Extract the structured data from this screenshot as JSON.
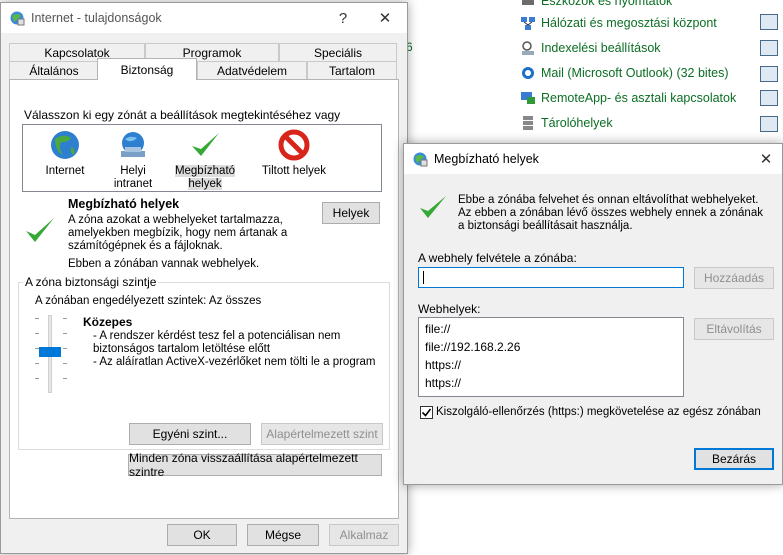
{
  "background": {
    "top_fragment": "",
    "items": [
      {
        "label": "Eszközök és nyomtatók",
        "icon": "printer-icon"
      },
      {
        "label": "Hálózati és megosztási központ",
        "icon": "network-icon"
      },
      {
        "label": "Indexelési beállítások",
        "icon": "index-search-icon"
      },
      {
        "label": "Mail (Microsoft Outlook) (32 bites)",
        "icon": "mail-icon"
      },
      {
        "label": "RemoteApp- és asztali kapcsolatok",
        "icon": "remote-desktop-icon"
      },
      {
        "label": "Tárolóhelyek",
        "icon": "storage-icon"
      }
    ],
    "fragment_6": "6"
  },
  "props": {
    "title": "Internet - tulajdonságok",
    "help": "?",
    "close": "✕",
    "tabs_row1": [
      "Kapcsolatok",
      "Programok",
      "Speciális"
    ],
    "tabs_row2": [
      "Általános",
      "Biztonság",
      "Adatvédelem",
      "Tartalom"
    ],
    "active_tab": "Biztonság",
    "instruction": "Válasszon ki egy zónát a beállítások megtekintéséhez vagy módosításához.",
    "zones": [
      {
        "label": "Internet",
        "icon": "globe-icon"
      },
      {
        "label": "Helyi intranet",
        "icon": "intranet-icon"
      },
      {
        "label": "Megbízható helyek",
        "icon": "check-icon",
        "selected": true
      },
      {
        "label": "Tiltott helyek",
        "icon": "forbidden-icon"
      }
    ],
    "zone_name": "Megbízható helyek",
    "zone_desc": "A zóna azokat a webhelyeket tartalmazza, amelyekben megbízik, hogy nem ártanak a számítógépnek és a fájloknak.",
    "zone_has_sites": "Ebben a zónában vannak webhelyek.",
    "sites_button": "Helyek",
    "group_title": "A zóna biztonsági szintje",
    "allowed_levels": "A zónában engedélyezett szintek: Az összes",
    "level_name": "Közepes",
    "level_bullet1": "- A rendszer kérdést tesz fel a potenciálisan nem biztonságos tartalom letöltése előtt",
    "level_bullet2": "- Az aláíratlan ActiveX-vezérlőket nem tölti le a program",
    "custom_level": "Egyéni szint...",
    "default_level": "Alapértelmezett szint",
    "reset_all": "Minden zóna visszaállítása alapértelmezett szintre",
    "ok": "OK",
    "cancel": "Mégse",
    "apply": "Alkalmaz"
  },
  "trusted": {
    "title": "Megbízható helyek",
    "close": "✕",
    "desc": "Ebbe a zónába felvehet és onnan eltávolíthat webhelyeket. Az ebben a zónában lévő összes webhely ennek a zónának a biztonsági beállításait használja.",
    "add_label": "A webhely felvétele a zónába:",
    "add_value": "",
    "add_button": "Hozzáadás",
    "sites_label": "Webhelyek:",
    "sites": [
      "file://",
      "file://192.168.2.26",
      "https://",
      "https://"
    ],
    "remove_button": "Eltávolítás",
    "https_checkbox": "Kiszolgáló-ellenőrzés (https:) megkövetelése az egész zónában",
    "https_checked": true,
    "close_button": "Bezárás"
  },
  "colors": {
    "accent": "#0078d7",
    "link_green": "#0b6e24",
    "check_green": "#35a835",
    "forbidden_red": "#d9241b"
  }
}
